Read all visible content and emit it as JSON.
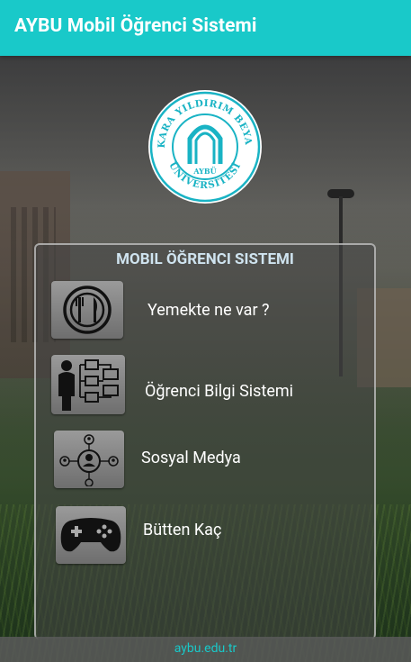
{
  "app_bar": {
    "title": "AYBU Mobil Öğrenci Sistemi"
  },
  "logo": {
    "ring_text_top": "ANKARA YILDIRIM BEYAZIT",
    "ring_text_bottom": "ÜNİVERSİTESİ",
    "center_text": "AYBÜ",
    "color": "#19b3c4"
  },
  "panel": {
    "title": "MOBIL ÖĞRENCI SISTEMI",
    "items": [
      {
        "label": "Yemekte ne var ?",
        "icon": "plate-fork-knife-icon"
      },
      {
        "label": "Öğrenci Bilgi Sistemi",
        "icon": "student-info-system-icon"
      },
      {
        "label": "Sosyal Medya",
        "icon": "social-network-icon"
      },
      {
        "label": "Bütten Kaç",
        "icon": "gamepad-icon"
      }
    ]
  },
  "footer": {
    "link": "aybu.edu.tr"
  },
  "colors": {
    "accent": "#19c9c9"
  }
}
